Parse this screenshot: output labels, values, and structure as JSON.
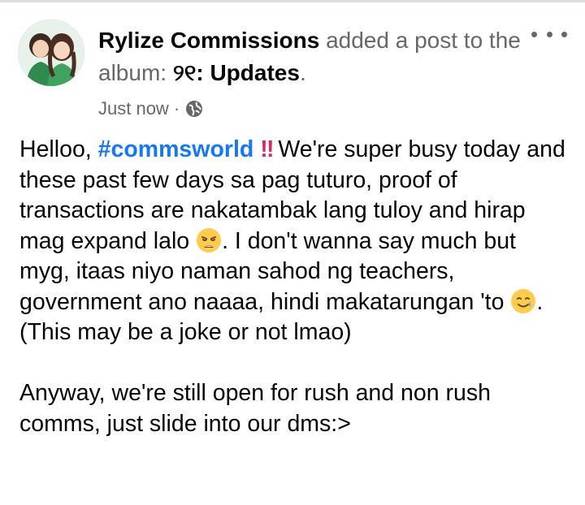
{
  "post": {
    "author": "Rylize Commissions",
    "action_text": " added a post to the album: ",
    "album_name": "୨୧: Updates",
    "album_suffix": ".",
    "timestamp": "Just now",
    "meta_separator": "·",
    "privacy_icon": "globe-icon",
    "more_icon": "more-options-icon",
    "avatar": "avatar-couple-illustration",
    "body": {
      "p1_part1": "Helloo, ",
      "hashtag": "#commsworld",
      "emoji_1": "double-exclamation-emoji",
      "emoji_1_char": "‼",
      "p1_part2": " We're super busy today and these past few days sa pag tuturo, proof of transactions are nakatambak lang tuloy and hirap mag expand lalo ",
      "emoji_2": "weary-face-emoji",
      "p1_part3": ". I don't wanna say much but myg, itaas niyo naman sahod ng teachers, government ano naaaa, hindi makatarungan 'to ",
      "emoji_3": "smiling-face-with-tear-emoji",
      "p1_part4": ". (This may be a joke or not lmao)",
      "p2": "Anyway, we're still open for rush and non rush comms, just slide into our dms:>"
    },
    "colors": {
      "name_text": "#050505",
      "secondary_text": "#65676b",
      "hashtag": "#1877f2",
      "exclamation": "#e0245e",
      "emoji_yellow": "#ffcc4d"
    }
  }
}
